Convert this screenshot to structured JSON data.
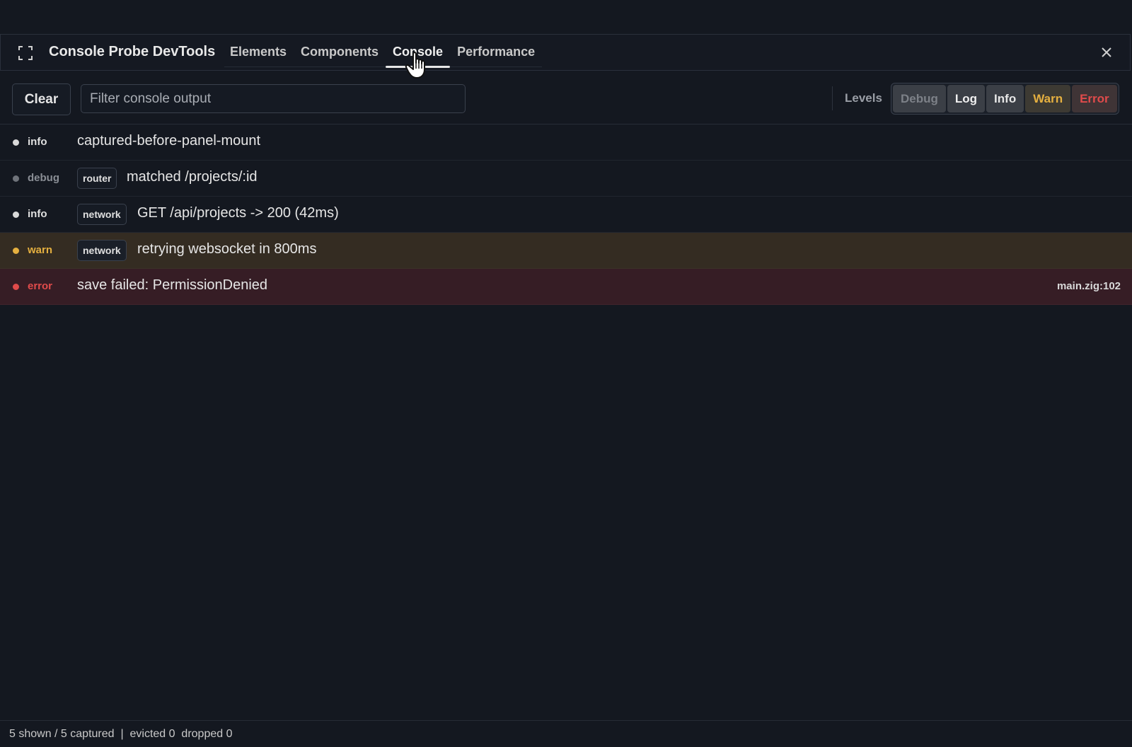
{
  "header": {
    "title": "Console Probe DevTools",
    "tabs": [
      {
        "label": "Elements"
      },
      {
        "label": "Components"
      },
      {
        "label": "Console"
      },
      {
        "label": "Performance"
      }
    ],
    "active_tab": "Console"
  },
  "toolbar": {
    "clear_label": "Clear",
    "filter_placeholder": "Filter console output",
    "filter_value": "",
    "levels_label": "Levels",
    "levels": [
      {
        "label": "Debug",
        "color": "#7d8188"
      },
      {
        "label": "Log",
        "color": "#f0f0f0"
      },
      {
        "label": "Info",
        "color": "#e6e6e6"
      },
      {
        "label": "Warn",
        "color": "#e5b040"
      },
      {
        "label": "Error",
        "color": "#e04b4b"
      }
    ]
  },
  "logs": [
    {
      "level": "info",
      "tag": "",
      "message": "captured-before-panel-mount",
      "source": ""
    },
    {
      "level": "debug",
      "tag": "router",
      "message": "matched /projects/:id",
      "source": ""
    },
    {
      "level": "info",
      "tag": "network",
      "message": "GET /api/projects -> 200 (42ms)",
      "source": ""
    },
    {
      "level": "warn",
      "tag": "network",
      "message": "retrying websocket in 800ms",
      "source": ""
    },
    {
      "level": "error",
      "tag": "",
      "message": "save failed: PermissionDenied",
      "source": "main.zig:102"
    }
  ],
  "colors": {
    "info_dot": "#d9d9d9",
    "debug_dot": "#6f737a",
    "warn": "#e5b040",
    "error": "#e04b4b",
    "debug_text": "#8a8e95",
    "info_text": "#e0e0e0"
  },
  "status": {
    "shown": "5 shown / 5 captured",
    "separator": "|",
    "evicted": "evicted 0",
    "dropped": "dropped 0"
  }
}
